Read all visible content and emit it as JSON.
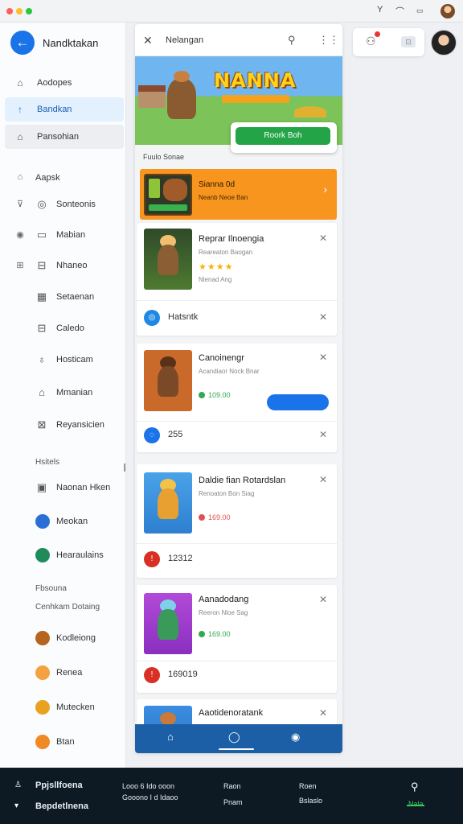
{
  "sidebar": {
    "title": "Nandktakan",
    "nav": [
      {
        "label": "Aodopes",
        "icon": "home-icon"
      },
      {
        "label": "Bandkan",
        "icon": "pin-icon"
      },
      {
        "label": "Pansohian",
        "icon": "tag-icon"
      }
    ],
    "section_items": [
      {
        "label": "Aapsk",
        "icon1": "bag-icon"
      },
      {
        "label": "Sonteonis",
        "icon1": "shield-icon",
        "icon2": "globe-icon"
      },
      {
        "label": "Mabian",
        "icon1": "record-icon",
        "icon2": "square-icon"
      },
      {
        "label": "Nhaneo",
        "icon1": "grid-icon",
        "icon2": "news-icon"
      },
      {
        "label": "Setaenan",
        "icon2": "table-icon"
      },
      {
        "label": "Caledo",
        "icon2": "minus-box-icon"
      },
      {
        "label": "Hosticam",
        "icon2": "location-icon"
      },
      {
        "label": "Mmanian",
        "icon2": "shop-icon"
      },
      {
        "label": "Reyansicien",
        "icon2": "book-icon"
      }
    ],
    "heading1": "Hsitels",
    "section2_items": [
      {
        "label": "Naonan Hken",
        "icon2": "image-icon"
      },
      {
        "label": "Meokan",
        "icon2": "compass-icon"
      },
      {
        "label": "Hearaulains",
        "icon2": "chat-icon"
      }
    ],
    "heading2": "Fbsouna",
    "heading3": "Cenhkam Dotaing",
    "contacts": [
      {
        "label": "Kodleiong",
        "color": "#b5651d"
      },
      {
        "label": "Renea",
        "color": "#f4a142"
      },
      {
        "label": "Mutecken",
        "color": "#e9a21f"
      },
      {
        "label": "Btan",
        "color": "#f08a24"
      }
    ]
  },
  "panel": {
    "title": "Nelangan",
    "hero": {
      "logo": "NANNA",
      "button": "Roork Boh"
    },
    "section_label": "Fuulo Sonae",
    "promo": {
      "title": "Sianna 0d",
      "subtitle": "Neanb Neoe Ban"
    },
    "cards": [
      {
        "title": "Reprar Ilnoengia",
        "subtitle": "Reareaton Baogan",
        "stars": "★★★★",
        "meta": "Nlenad Ang",
        "footer_text": "Hatsntk",
        "footer_color": "#1e88e5",
        "footer_icon": "globe-icon"
      },
      {
        "title": "Canoinengr",
        "subtitle": "Acandiaor Nock Bnar",
        "price": "109.00",
        "price_color": "#34a853",
        "footer_text": "255",
        "footer_color": "#1a73e8",
        "footer_icon": "swirl-icon"
      },
      {
        "title": "Daldie fian Rotardslan",
        "subtitle": "Renoaton Bon Siag",
        "price": "169.00",
        "price_color": "#e05252",
        "footer_text": "12312",
        "footer_color": "#d93025",
        "footer_icon": "alert-icon"
      },
      {
        "title": "Aanadodang",
        "subtitle": "Reeron Nloe Sag",
        "price": "169.00",
        "price_color": "#34a853",
        "footer_text": "169019",
        "footer_color": "#d93025",
        "footer_icon": "alert-icon"
      },
      {
        "title": "Aaotidenoratank"
      }
    ]
  },
  "dock": {
    "left_line1": "Ppjsllfoena",
    "left_line2": "Bepdetlnena",
    "mid1_line1": "Looo 6 Ido ooon",
    "mid1_line2": "Gooono I d Idaoo",
    "mid2_line1": "Raon",
    "mid2_line2": "Pnam",
    "mid3_line1": "Roen",
    "mid3_line2": "Bslaslo",
    "right_label": "Nala"
  }
}
